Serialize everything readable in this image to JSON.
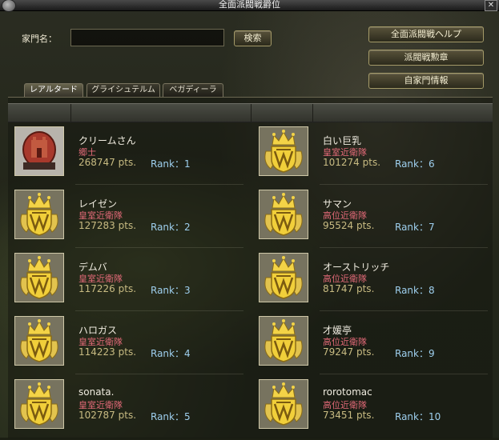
{
  "window": {
    "title": "全面派閥戦爵位",
    "close_label": "✕"
  },
  "search": {
    "label": "家門名：",
    "value": "",
    "placeholder": "",
    "button_label": "検索"
  },
  "side_buttons": [
    "全面派閥戦ヘルプ",
    "派閥戦勲章",
    "自家門情報"
  ],
  "tabs": [
    {
      "label": "レアルタード",
      "active": true
    },
    {
      "label": "グライシュテルム",
      "active": false
    },
    {
      "label": "ベガディーラ",
      "active": false
    }
  ],
  "entries": [
    {
      "name": "クリームさん",
      "rank": "郷士",
      "points": "268747 pts.",
      "rank_label": "Rank：1",
      "emblem": "red-castle-crest"
    },
    {
      "name": "レイゼン",
      "rank": "皇室近衛隊",
      "points": "127283 pts.",
      "rank_label": "Rank：2",
      "emblem": "gold-crown-crest"
    },
    {
      "name": "デムバ",
      "rank": "皇室近衛隊",
      "points": "117226 pts.",
      "rank_label": "Rank：3",
      "emblem": "gold-crown-crest"
    },
    {
      "name": "ハロガス",
      "rank": "皇室近衛隊",
      "points": "114223 pts.",
      "rank_label": "Rank：4",
      "emblem": "gold-crown-crest"
    },
    {
      "name": "sonata.",
      "rank": "皇室近衛隊",
      "points": "102787 pts.",
      "rank_label": "Rank：5",
      "emblem": "gold-crown-crest"
    },
    {
      "name": "白い巨乳",
      "rank": "皇室近衛隊",
      "points": "101274 pts.",
      "rank_label": "Rank：6",
      "emblem": "gold-crown-crest"
    },
    {
      "name": "サマン",
      "rank": "高位近衛隊",
      "points": "95524 pts.",
      "rank_label": "Rank：7",
      "emblem": "gold-crown-crest"
    },
    {
      "name": "オーストリッチ",
      "rank": "高位近衛隊",
      "points": "81747 pts.",
      "rank_label": "Rank：8",
      "emblem": "gold-crown-crest"
    },
    {
      "name": "才媛亭",
      "rank": "高位近衛隊",
      "points": "79247 pts.",
      "rank_label": "Rank：9",
      "emblem": "gold-crown-crest"
    },
    {
      "name": "rorotomac",
      "rank": "高位近衛隊",
      "points": "73451 pts.",
      "rank_label": "Rank：10",
      "emblem": "gold-crown-crest"
    }
  ],
  "colors": {
    "name": "#f0ece0",
    "rank": "#e36a78",
    "points": "#c8bb82",
    "rank_label": "#9ecfee",
    "button_border": "#a49a68"
  }
}
